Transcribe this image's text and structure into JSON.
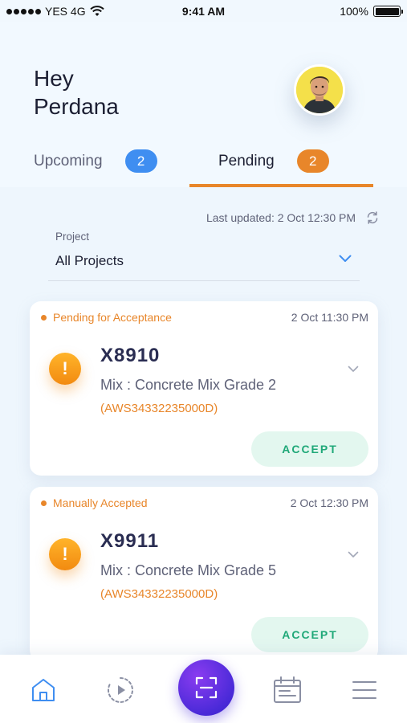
{
  "status_bar": {
    "carrier": "YES 4G",
    "time": "9:41 AM",
    "battery": "100%"
  },
  "header": {
    "greeting": "Hey\nPerdana"
  },
  "tabs": [
    {
      "label": "Upcoming",
      "count": "2"
    },
    {
      "label": "Pending",
      "count": "2"
    }
  ],
  "last_updated": "Last updated: 2 Oct 12:30 PM",
  "filter": {
    "label": "Project",
    "value": "All Projects"
  },
  "cards": [
    {
      "status": "Pending for Acceptance",
      "time": "2 Oct 11:30 PM",
      "code": "X8910",
      "mix": "Mix : Concrete Mix Grade 2",
      "ref": "(AWS34332235000D)",
      "action": "ACCEPT"
    },
    {
      "status": "Manually Accepted",
      "time": "2 Oct 12:30 PM",
      "code": "X9911",
      "mix": "Mix : Concrete Mix Grade 5",
      "ref": "(AWS34332235000D)",
      "action": "ACCEPT"
    }
  ],
  "icons": {
    "warning": "!",
    "nav": [
      "home-icon",
      "progress-icon",
      "scan-icon",
      "calendar-icon",
      "menu-icon"
    ]
  },
  "colors": {
    "accent_orange": "#e8862a",
    "accent_blue": "#3f8ef1",
    "accept_green": "#1fa878",
    "scan_purple": "#5a2ce0"
  }
}
